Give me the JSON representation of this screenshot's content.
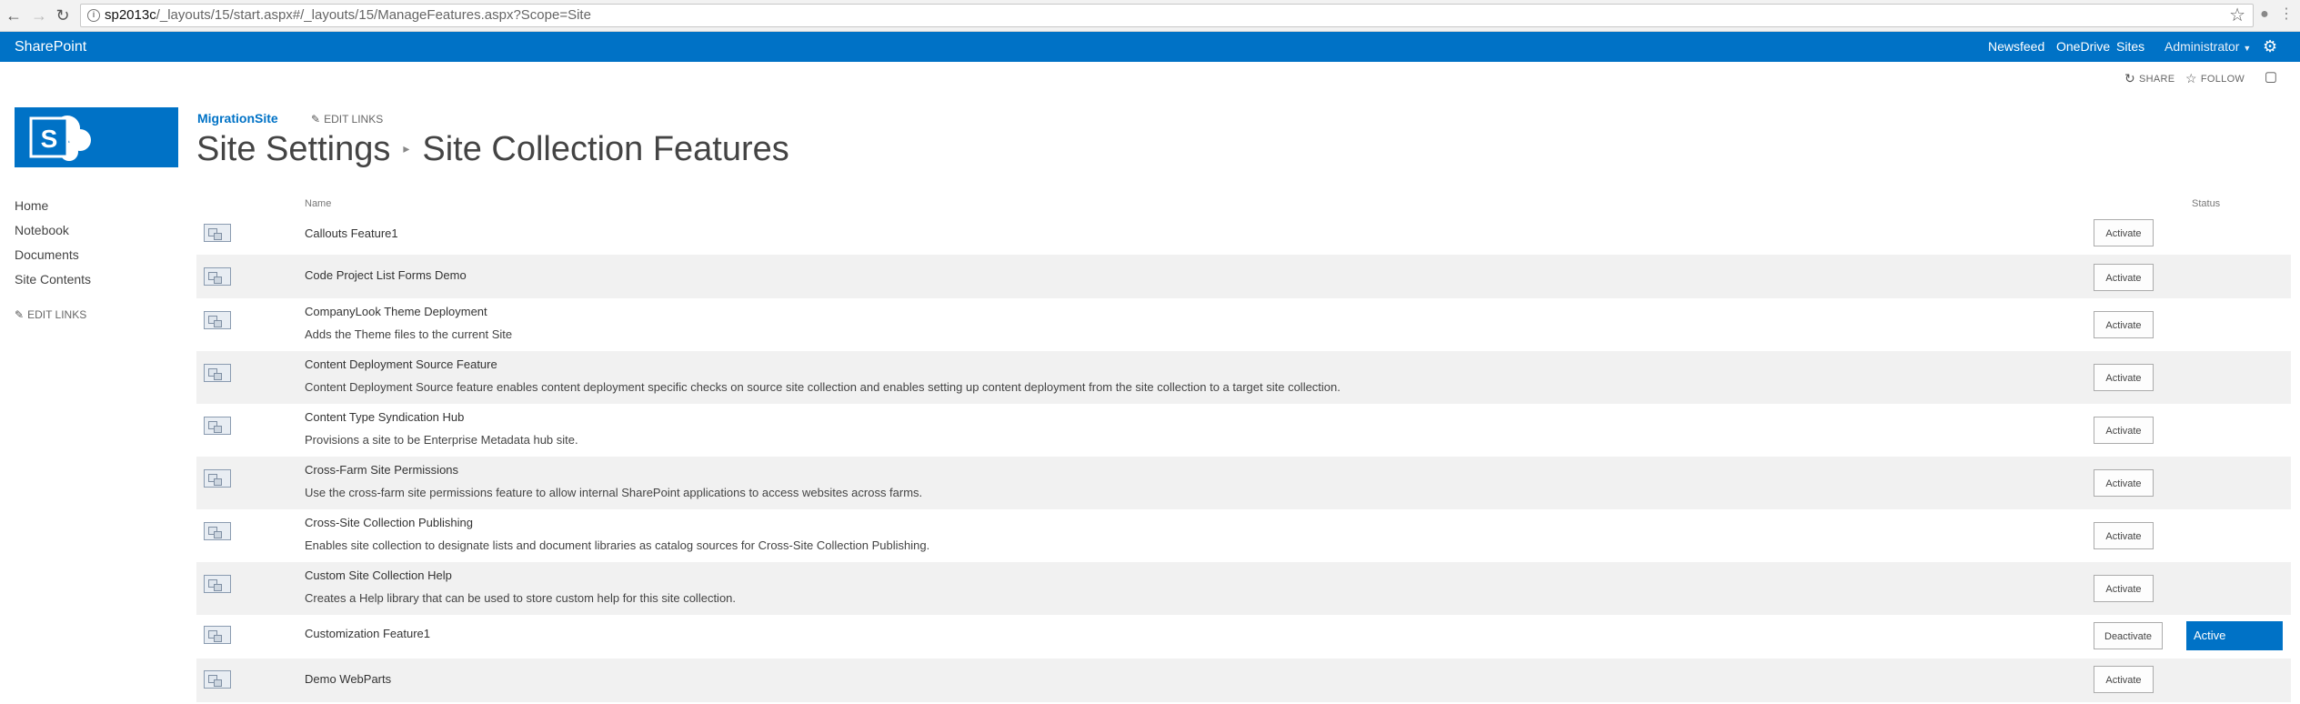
{
  "browser": {
    "url_host": "sp2013c",
    "url_path": "/_layouts/15/start.aspx#/_layouts/15/ManageFeatures.aspx?Scope=Site"
  },
  "suite": {
    "brand": "SharePoint",
    "links": [
      "Newsfeed",
      "OneDrive",
      "Sites"
    ],
    "user": "Administrator"
  },
  "actions": {
    "share": "SHARE",
    "follow": "FOLLOW"
  },
  "header": {
    "site_name": "MigrationSite",
    "edit_links": "EDIT LINKS",
    "title_parent": "Site Settings",
    "title_current": "Site Collection Features"
  },
  "quick_launch": {
    "items": [
      "Home",
      "Notebook",
      "Documents",
      "Site Contents"
    ],
    "edit_links": "EDIT LINKS"
  },
  "table": {
    "col_name": "Name",
    "col_status": "Status",
    "features": [
      {
        "title": "Callouts Feature1",
        "description": "",
        "button": "Activate",
        "status": ""
      },
      {
        "title": "Code Project List Forms Demo",
        "description": "",
        "button": "Activate",
        "status": ""
      },
      {
        "title": "CompanyLook Theme Deployment",
        "description": "Adds the Theme files to the current Site",
        "button": "Activate",
        "status": ""
      },
      {
        "title": "Content Deployment Source Feature",
        "description": "Content Deployment Source feature enables content deployment specific checks on source site collection and enables setting up content deployment from the site collection to a target site collection.",
        "button": "Activate",
        "status": ""
      },
      {
        "title": "Content Type Syndication Hub",
        "description": "Provisions a site to be Enterprise Metadata hub site.",
        "button": "Activate",
        "status": ""
      },
      {
        "title": "Cross-Farm Site Permissions",
        "description": "Use the cross-farm site permissions feature to allow internal SharePoint applications to access websites across farms.",
        "button": "Activate",
        "status": ""
      },
      {
        "title": "Cross-Site Collection Publishing",
        "description": "Enables site collection to designate lists and document libraries as catalog sources for Cross-Site Collection Publishing.",
        "button": "Activate",
        "status": ""
      },
      {
        "title": "Custom Site Collection Help",
        "description": "Creates a Help library that can be used to store custom help for this site collection.",
        "button": "Activate",
        "status": ""
      },
      {
        "title": "Customization Feature1",
        "description": "",
        "button": "Deactivate",
        "status": "Active"
      },
      {
        "title": "Demo WebParts",
        "description": "",
        "button": "Activate",
        "status": ""
      }
    ]
  }
}
